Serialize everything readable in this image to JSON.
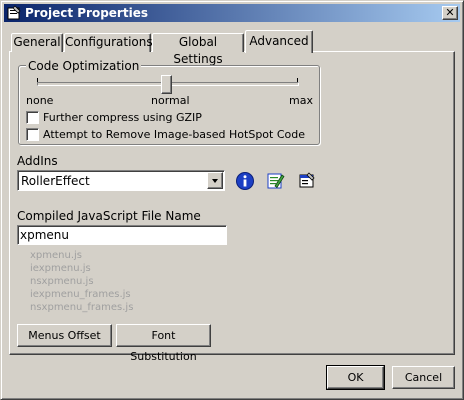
{
  "window": {
    "title": "Project Properties",
    "close_glyph": "✕"
  },
  "tabs": [
    {
      "label": "General"
    },
    {
      "label": "Configurations"
    },
    {
      "label": "Global Settings"
    },
    {
      "label": "Advanced",
      "active": true
    }
  ],
  "code_optimization": {
    "group_label": "Code Optimization",
    "slider": {
      "min_label": "none",
      "mid_label": "normal",
      "max_label": "max",
      "selected": "normal"
    },
    "checkboxes": [
      {
        "label": "Further compress using GZIP",
        "checked": false
      },
      {
        "label": "Attempt to Remove Image-based HotSpot Code",
        "checked": false
      }
    ]
  },
  "addins": {
    "label": "AddIns",
    "selected": "RollerEffect",
    "icons": [
      "info-icon",
      "edit-addin-icon",
      "addin-properties-icon"
    ]
  },
  "compiled_js": {
    "label": "Compiled JavaScript File Name",
    "value": "xpmenu",
    "files": [
      "xpmenu.js",
      "iexpmenu.js",
      "nsxpmenu.js",
      "iexpmenu_frames.js",
      "nsxpmenu_frames.js"
    ]
  },
  "buttons": {
    "menus_offset": "Menus Offset",
    "font_substitution": "Font Substitution",
    "ok": "OK",
    "cancel": "Cancel"
  },
  "colors": {
    "titlebar_start": "#0a246a",
    "titlebar_end": "#a6caf0",
    "face": "#d4d0c8",
    "disabled_text": "#a0a0a0"
  }
}
